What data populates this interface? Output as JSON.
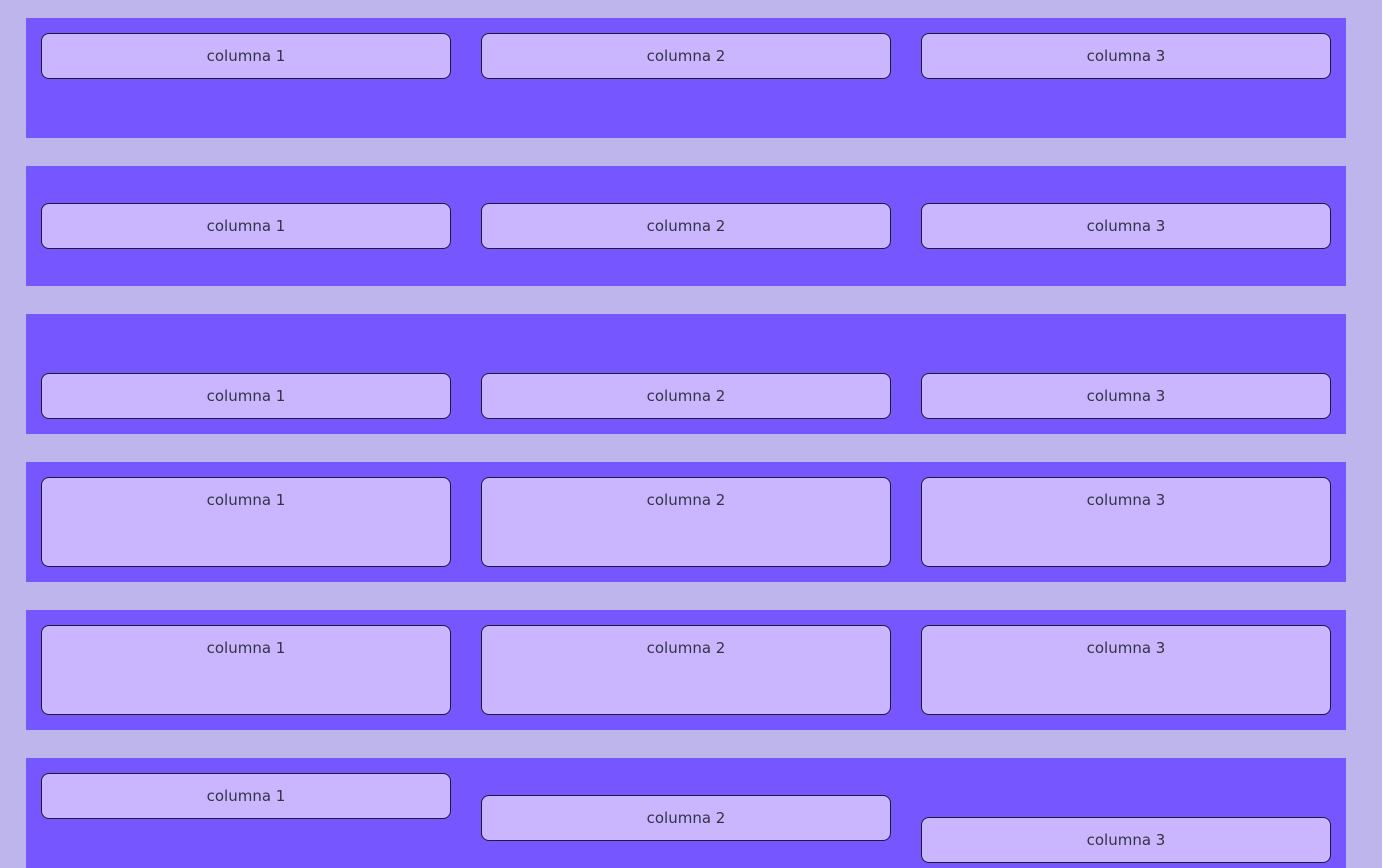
{
  "rows": [
    {
      "cells": [
        "columna 1",
        "columna 2",
        "columna 3"
      ]
    },
    {
      "cells": [
        "columna 1",
        "columna 2",
        "columna 3"
      ]
    },
    {
      "cells": [
        "columna 1",
        "columna 2",
        "columna 3"
      ]
    },
    {
      "cells": [
        "columna 1",
        "columna 2",
        "columna 3"
      ]
    },
    {
      "cells": [
        "columna 1",
        "columna 2",
        "columna 3"
      ]
    },
    {
      "cells": [
        "columna 1",
        "columna 2",
        "columna 3"
      ]
    }
  ],
  "colors": {
    "page_background": "#bdb5ec",
    "row_background": "#7657ff",
    "cell_background": "#cab6ff",
    "cell_border": "#1e1a3a"
  }
}
